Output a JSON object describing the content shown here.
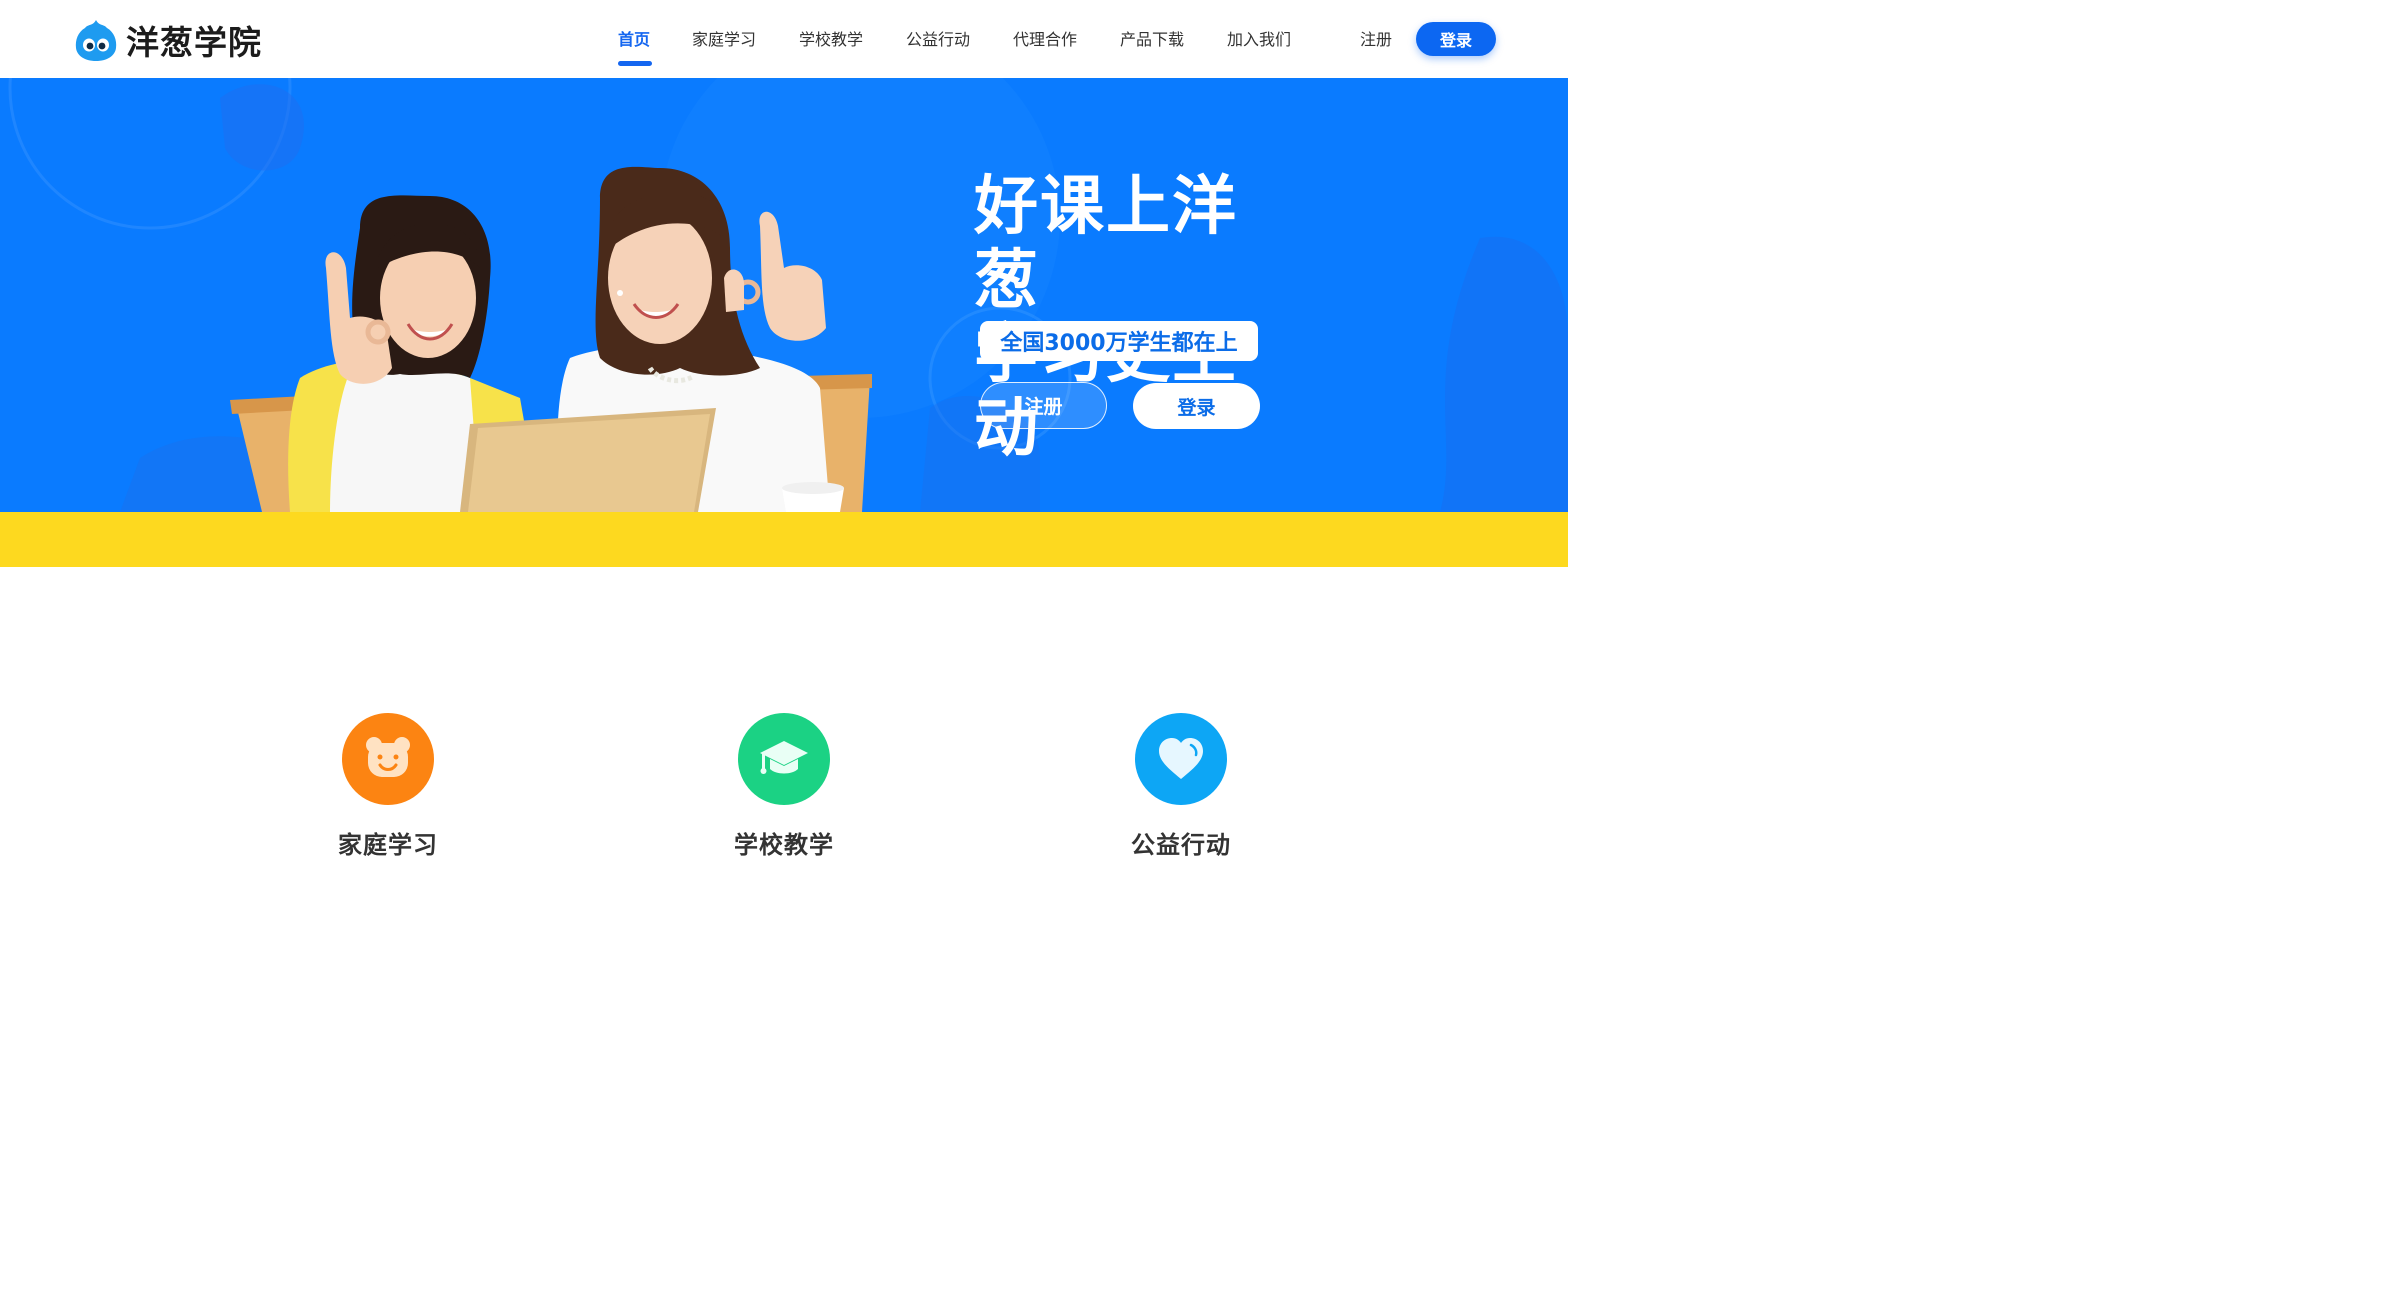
{
  "brand": {
    "name": "洋葱学院"
  },
  "nav": {
    "items": [
      {
        "label": "首页",
        "active": true
      },
      {
        "label": "家庭学习"
      },
      {
        "label": "学校教学"
      },
      {
        "label": "公益行动"
      },
      {
        "label": "代理合作"
      },
      {
        "label": "产品下载"
      },
      {
        "label": "加入我们"
      }
    ],
    "register_label": "注册",
    "login_label": "登录"
  },
  "hero": {
    "title_line1": "好课上洋葱",
    "title_line2": "学习更主动",
    "tagline": "全国3000万学生都在上",
    "register_label": "注册",
    "login_label": "登录"
  },
  "features": [
    {
      "label": "家庭学习",
      "icon": "bear-face-icon",
      "color": "#fc8412"
    },
    {
      "label": "学校教学",
      "icon": "graduation-cap-icon",
      "color": "#1bd284"
    },
    {
      "label": "公益行动",
      "icon": "heart-icon",
      "color": "#0da6f5"
    }
  ],
  "colors": {
    "accent": "#1466f0",
    "hero_bg": "#0a7bff",
    "band": "#fdd91f"
  }
}
